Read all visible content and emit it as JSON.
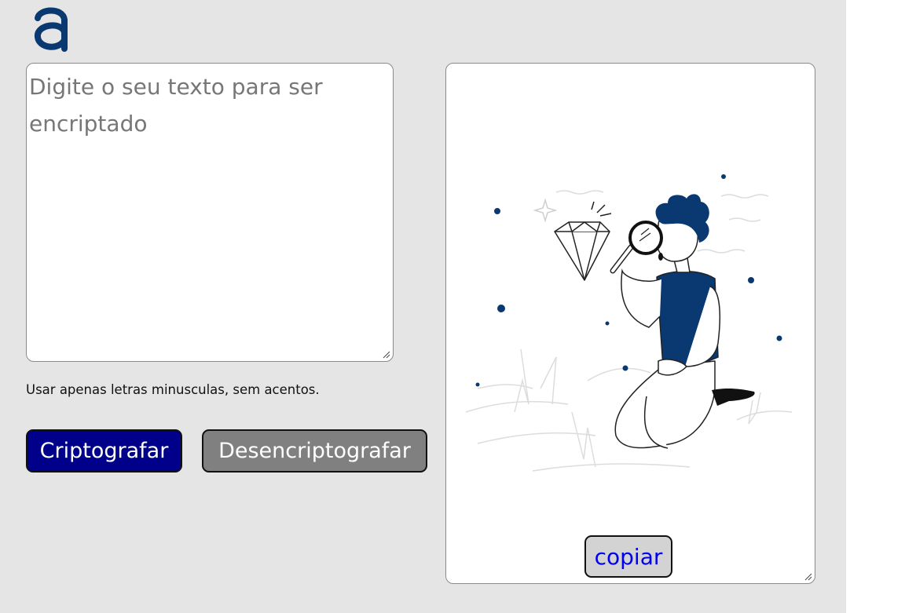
{
  "logo": {
    "icon": "alura-a-logo-icon",
    "color": "#0a3871"
  },
  "input": {
    "value": "",
    "placeholder": "Digite o seu texto para ser encriptado"
  },
  "hint": "Usar apenas letras minusculas, sem acentos.",
  "buttons": {
    "encrypt_label": "Criptografar",
    "decrypt_label": "Desencriptografar",
    "copy_label": "copiar"
  },
  "output": {
    "illustration": "person-with-magnifying-glass-looking-at-diamond"
  },
  "colors": {
    "page_background": "#e5e5e5",
    "encrypt_button": "#00008b",
    "decrypt_button": "#808080",
    "copy_button": "#d3d3d3",
    "copy_text": "#0000ee",
    "illustration_accent": "#0a3871"
  }
}
